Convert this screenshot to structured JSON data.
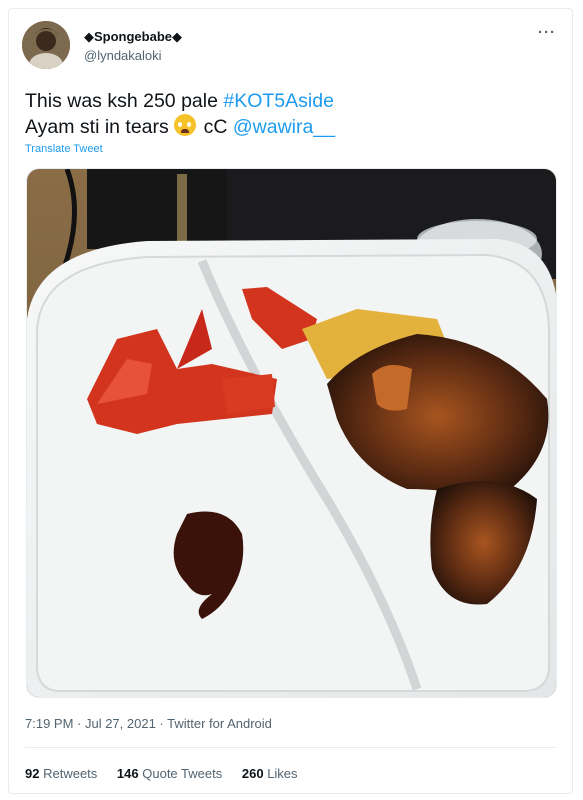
{
  "tweet": {
    "display_name": "◆Spongebabe◆",
    "handle": "@lyndakaloki",
    "more_icon": "more-horizontal-icon",
    "text_line1_plain": "This was ksh 250 pale ",
    "text_line1_hashtag": "#KOT5Aside",
    "text_line2_plain": "Ayam sti in tears ",
    "text_line2_emoji": "crying-face-emoji",
    "text_line2_after": " cC ",
    "text_line2_mention": "@wawira__",
    "translate_label": "Translate Tweet",
    "timestamp": "7:19 PM · Jul 27, 2021 · Twitter for Android"
  },
  "stats": {
    "retweets_count": "92",
    "retweets_label": "Retweets",
    "quotes_count": "146",
    "quotes_label": "Quote Tweets",
    "likes_count": "260",
    "likes_label": "Likes"
  },
  "colors": {
    "link": "#1d9bf0",
    "text": "#0f1419",
    "secondary": "#536471",
    "border": "#e6ecf0"
  }
}
